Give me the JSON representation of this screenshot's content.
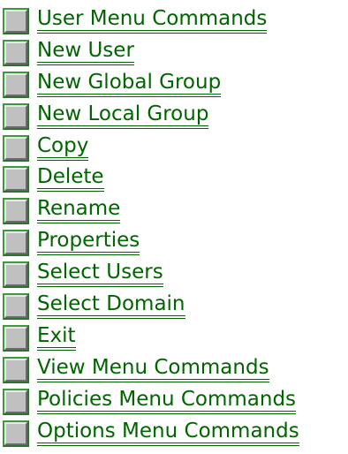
{
  "topics": [
    {
      "label": "User Menu Commands"
    },
    {
      "label": "New User"
    },
    {
      "label": "New Global Group"
    },
    {
      "label": "New Local Group"
    },
    {
      "label": "Copy"
    },
    {
      "label": "Delete"
    },
    {
      "label": "Rename"
    },
    {
      "label": "Properties"
    },
    {
      "label": "Select Users"
    },
    {
      "label": "Select Domain"
    },
    {
      "label": "Exit"
    },
    {
      "label": "View Menu Commands"
    },
    {
      "label": "Policies Menu Commands"
    },
    {
      "label": "Options Menu Commands"
    }
  ],
  "colors": {
    "link": "#006400",
    "button_face": "#c0c0c0",
    "button_outline": "#3c9a3c",
    "background": "#ffffff"
  },
  "icon_name": "help-topic-button-icon"
}
